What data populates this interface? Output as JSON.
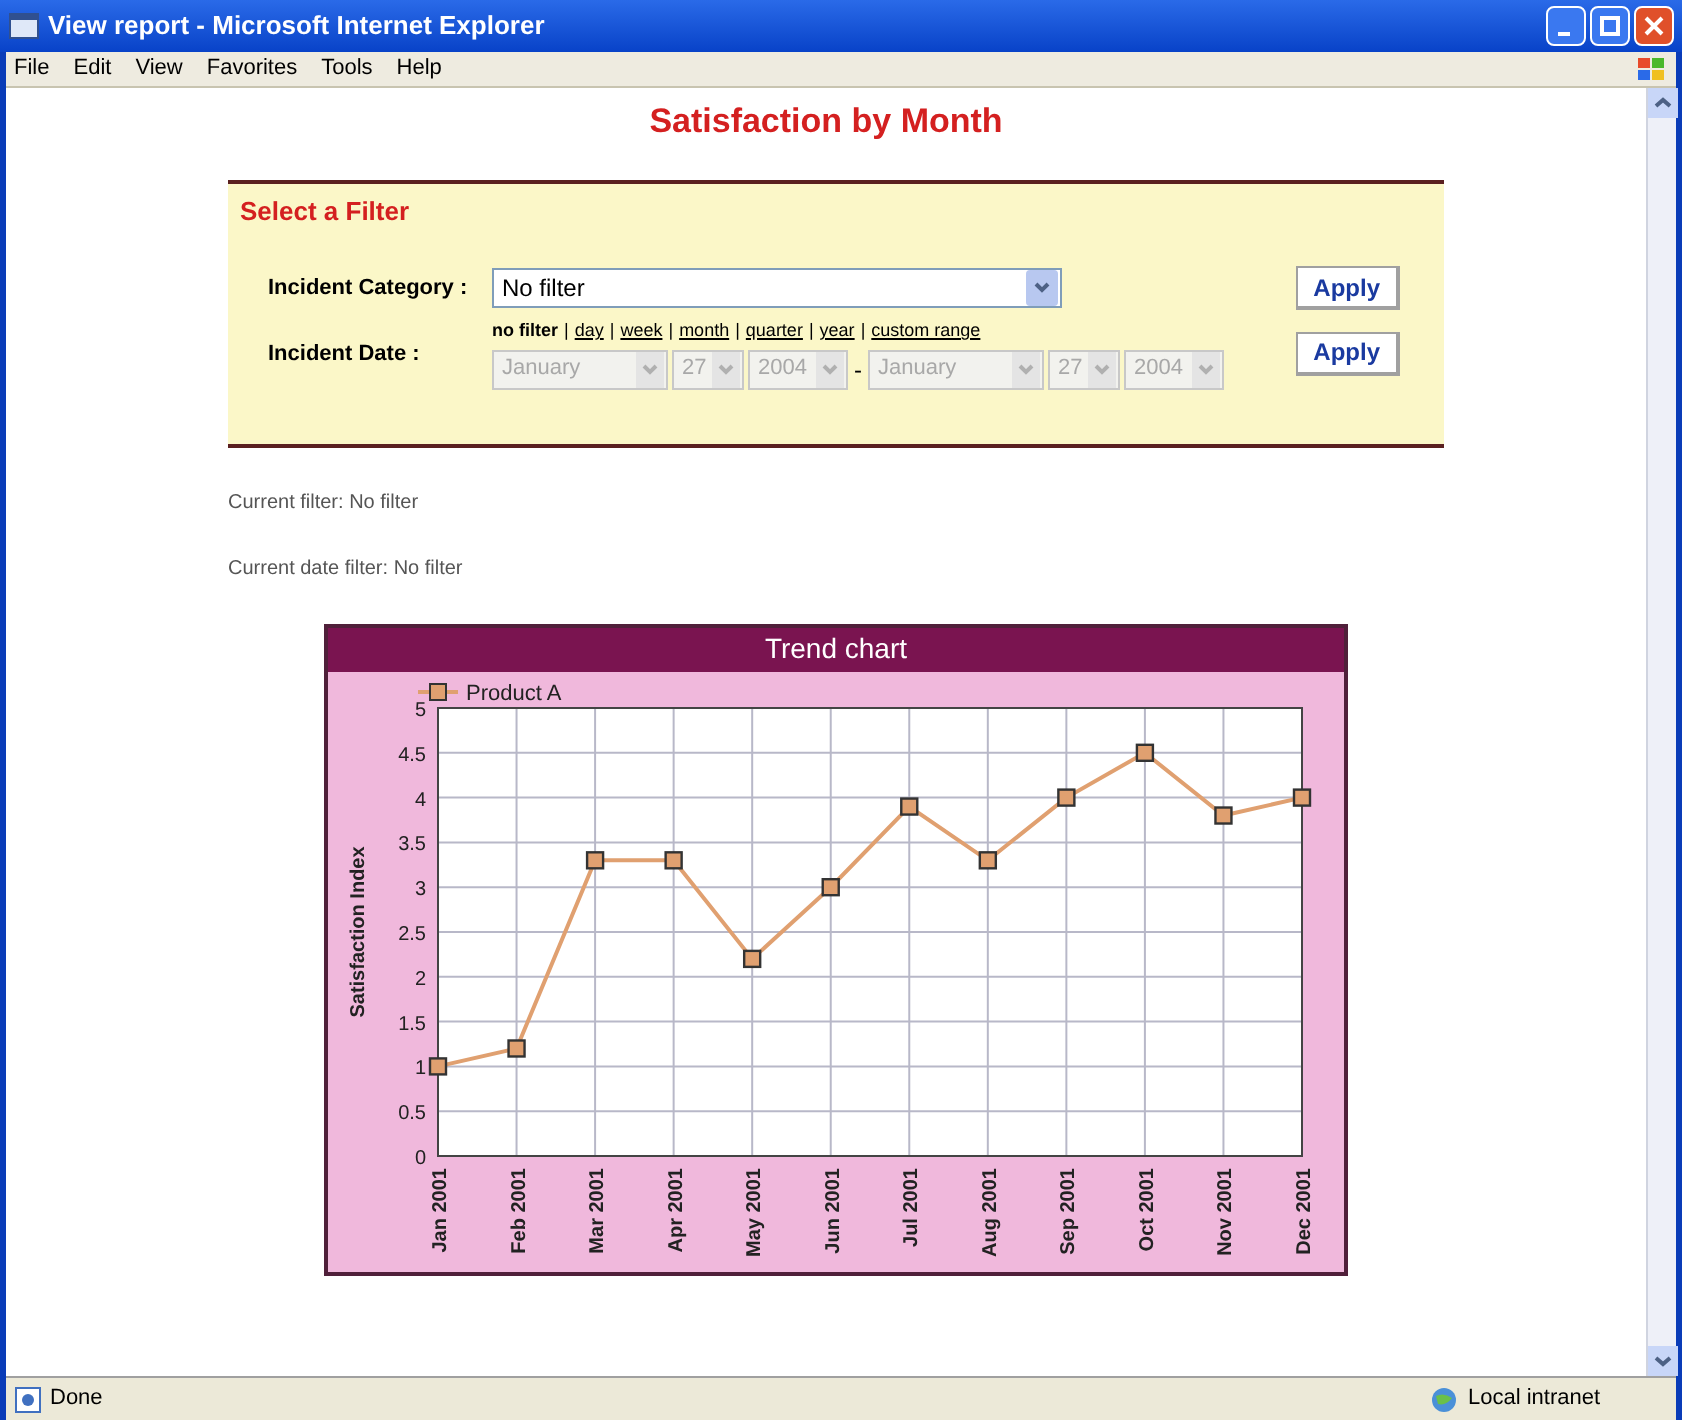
{
  "window": {
    "title": "View report - Microsoft Internet Explorer"
  },
  "menu": [
    "File",
    "Edit",
    "View",
    "Favorites",
    "Tools",
    "Help"
  ],
  "page": {
    "heading": "Satisfaction by Month"
  },
  "filter": {
    "title": "Select a Filter",
    "category": {
      "label": "Incident Category :",
      "value": "No filter",
      "button": "Apply"
    },
    "date": {
      "label": "Incident Date :",
      "button": "Apply",
      "links": [
        {
          "label": "no filter",
          "selected": true
        },
        {
          "label": "day",
          "selected": false
        },
        {
          "label": "week",
          "selected": false
        },
        {
          "label": "month",
          "selected": false
        },
        {
          "label": "quarter",
          "selected": false
        },
        {
          "label": "year",
          "selected": false
        },
        {
          "label": "custom range",
          "selected": false
        }
      ],
      "link_separator": "|",
      "separator": "-",
      "selects": [
        {
          "value": "January",
          "kind": "wide",
          "disabled": true
        },
        {
          "value": "27",
          "kind": "narrow",
          "disabled": true
        },
        {
          "value": "2004",
          "kind": "mid",
          "disabled": true
        },
        {
          "value": "January",
          "kind": "wide",
          "disabled": true
        },
        {
          "value": "27",
          "kind": "narrow",
          "disabled": true
        },
        {
          "value": "2004",
          "kind": "mid",
          "disabled": true
        }
      ]
    }
  },
  "current_filter": "Current filter: No filter",
  "current_date_filter": "Current date filter: No filter",
  "chart_panel": {
    "title": "Trend chart",
    "chart_data": {
      "type": "line",
      "grid": true,
      "ylabel": "Satisfaction Index",
      "categories": [
        "Jan 2001",
        "Feb 2001",
        "Mar 2001",
        "Apr 2001",
        "May 2001",
        "Jun 2001",
        "Jul 2001",
        "Aug 2001",
        "Sep 2001",
        "Oct 2001",
        "Nov 2001",
        "Dec 2001"
      ],
      "series": [
        {
          "name": "Product A",
          "color": "#e0a070",
          "marker": "square",
          "values": [
            1,
            1.2,
            3.3,
            3.3,
            2.2,
            3,
            3.9,
            3.3,
            4,
            4.5,
            3.8,
            4
          ]
        }
      ],
      "ylim": [
        0,
        5
      ],
      "yticks": [
        {
          "value": 0,
          "label": "0"
        },
        {
          "value": 0.5,
          "label": "0.5"
        },
        {
          "value": 1,
          "label": "1"
        },
        {
          "value": 1.5,
          "label": "1.5"
        },
        {
          "value": 2,
          "label": "2"
        },
        {
          "value": 2.5,
          "label": "2.5"
        },
        {
          "value": 3,
          "label": "3"
        },
        {
          "value": 3.5,
          "label": "3.5"
        },
        {
          "value": 4,
          "label": "4"
        },
        {
          "value": 4.5,
          "label": "4.5"
        },
        {
          "value": 5,
          "label": "5"
        }
      ]
    }
  },
  "status_bar": {
    "status": "Done",
    "zone": "Local intranet"
  }
}
